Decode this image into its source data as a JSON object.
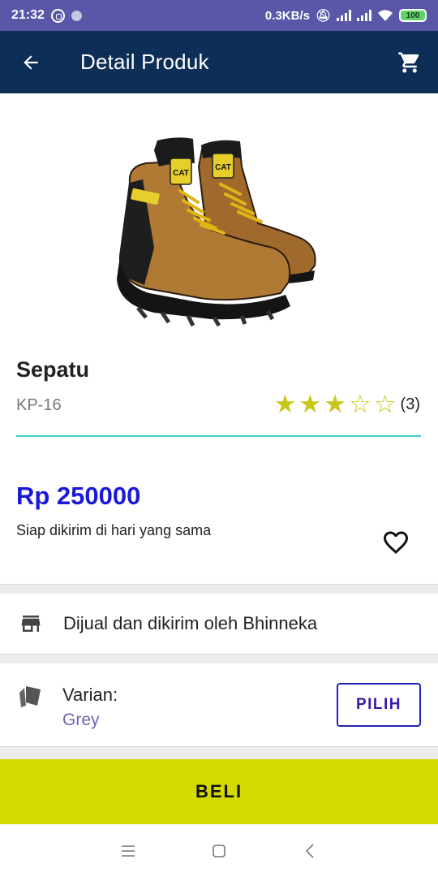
{
  "status_bar": {
    "time": "21:32",
    "net_speed": "0.3KB/s",
    "battery": "100",
    "icons": [
      "whatsapp-icon",
      "notification-dot-icon",
      "mute-bell-icon",
      "signal-icon",
      "signal-icon",
      "wifi-icon",
      "battery-icon"
    ]
  },
  "app_bar": {
    "title": "Detail Produk",
    "back_icon": "arrow-left-icon",
    "cart_icon": "shopping-cart-icon"
  },
  "product": {
    "name": "Sepatu",
    "code": "KP-16",
    "rating": 3,
    "rating_max": 5,
    "rating_count": "(3)",
    "price": "Rp 250000",
    "ship_note": "Siap dikirim di hari yang sama",
    "wishlist_icon": "heart-outline-icon"
  },
  "seller": {
    "text": "Dijual dan dikirim oleh Bhinneka",
    "icon": "store-icon"
  },
  "variant": {
    "label": "Varian:",
    "value": "Grey",
    "button": "PILIH",
    "icon": "tag-icon"
  },
  "buy_button": "BELI",
  "colors": {
    "status_bar": "#5a56a8",
    "app_bar": "#0d2e57",
    "price": "#1a1ad6",
    "divider": "#3cd2c8",
    "star": "#c9c71a",
    "buy_button": "#d4da00",
    "variant_value": "#6a66b6"
  },
  "nav_icons": [
    "menu-icon",
    "home-square-icon",
    "back-chevron-icon"
  ]
}
